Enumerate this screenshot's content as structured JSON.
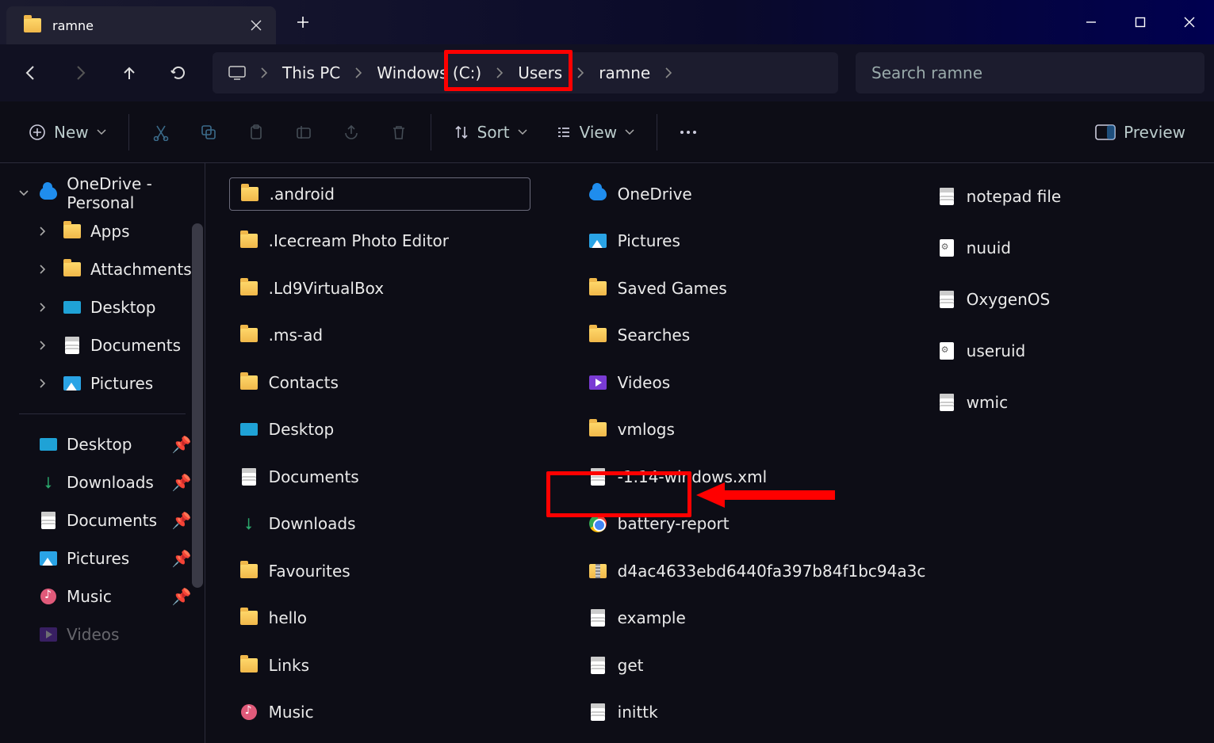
{
  "window": {
    "tab_title": "ramne"
  },
  "breadcrumb": {
    "root_label": "This PC",
    "drive_label": "Windows (C:)",
    "users_label": "Users",
    "current_label": "ramne"
  },
  "search": {
    "placeholder": "Search ramne"
  },
  "toolbar": {
    "new_label": "New",
    "sort_label": "Sort",
    "view_label": "View",
    "preview_label": "Preview"
  },
  "sidebar": {
    "onedrive_label": "OneDrive - Personal",
    "onedrive_children": [
      {
        "label": "Apps"
      },
      {
        "label": "Attachments"
      },
      {
        "label": "Desktop"
      },
      {
        "label": "Documents"
      },
      {
        "label": "Pictures"
      }
    ],
    "quick": [
      {
        "label": "Desktop"
      },
      {
        "label": "Downloads"
      },
      {
        "label": "Documents"
      },
      {
        "label": "Pictures"
      },
      {
        "label": "Music"
      },
      {
        "label": "Videos"
      }
    ]
  },
  "files": {
    "col1": [
      {
        "icon": "folder",
        "label": ".android",
        "selected": true
      },
      {
        "icon": "folder",
        "label": ".Icecream Photo Editor"
      },
      {
        "icon": "folder",
        "label": ".Ld9VirtualBox"
      },
      {
        "icon": "folder",
        "label": ".ms-ad"
      },
      {
        "icon": "folder",
        "label": "Contacts"
      },
      {
        "icon": "desktop",
        "label": "Desktop"
      },
      {
        "icon": "docfolder",
        "label": "Documents"
      },
      {
        "icon": "download",
        "label": "Downloads"
      },
      {
        "icon": "folder",
        "label": "Favourites"
      },
      {
        "icon": "folder",
        "label": "hello"
      },
      {
        "icon": "folder",
        "label": "Links"
      },
      {
        "icon": "music",
        "label": "Music"
      }
    ],
    "col2": [
      {
        "icon": "onedrive",
        "label": "OneDrive"
      },
      {
        "icon": "picture",
        "label": "Pictures"
      },
      {
        "icon": "folder",
        "label": "Saved Games"
      },
      {
        "icon": "folder",
        "label": "Searches"
      },
      {
        "icon": "video",
        "label": "Videos"
      },
      {
        "icon": "folder",
        "label": "vmlogs"
      },
      {
        "icon": "doc",
        "label": "-1.14-windows.xml"
      },
      {
        "icon": "chrome",
        "label": "battery-report",
        "highlighted": true
      },
      {
        "icon": "zip",
        "label": "d4ac4633ebd6440fa397b84f1bc94a3c"
      },
      {
        "icon": "doc",
        "label": "example"
      },
      {
        "icon": "doc",
        "label": "get"
      },
      {
        "icon": "doc",
        "label": "inittk"
      }
    ],
    "col3": [
      {
        "icon": "doc",
        "label": "notepad file"
      },
      {
        "icon": "settingsdoc",
        "label": "nuuid"
      },
      {
        "icon": "doc",
        "label": "OxygenOS"
      },
      {
        "icon": "settingsdoc",
        "label": "useruid"
      },
      {
        "icon": "doc",
        "label": "wmic"
      }
    ]
  },
  "annotations": {
    "breadcrumb_highlight": "Windows (C:)",
    "file_highlight": "battery-report"
  }
}
